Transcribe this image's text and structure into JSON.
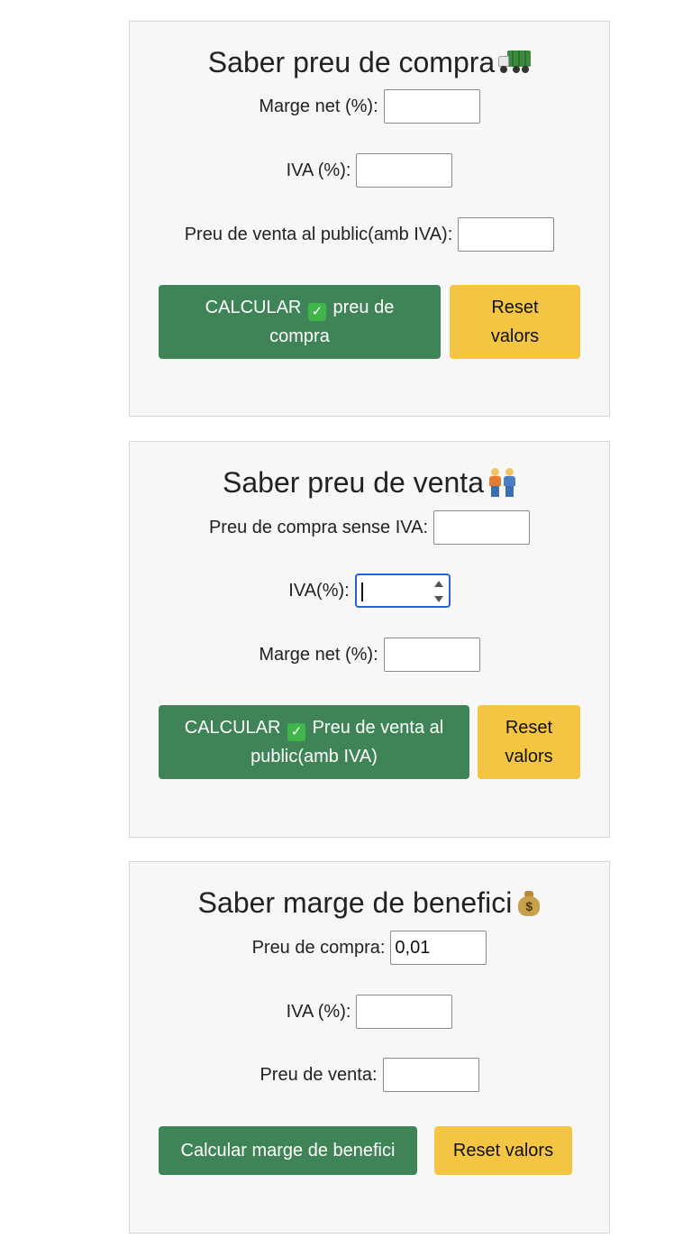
{
  "card_compra": {
    "title": "Saber preu de compra",
    "title_icon": "truck-icon",
    "fields": {
      "marge_label": "Marge net (%):",
      "marge_value": "",
      "iva_label": "IVA (%):",
      "iva_value": "",
      "pvp_label": "Preu de venta al public(amb IVA):",
      "pvp_value": ""
    },
    "calc_button_pre": "CALCULAR",
    "calc_button_line1_post": "preu de",
    "calc_button_line2": "compra",
    "reset_button_line1": "Reset",
    "reset_button_line2": "valors"
  },
  "card_venta": {
    "title": "Saber preu de venta",
    "title_icon": "people-holding-hands-icon",
    "fields": {
      "compra_label": "Preu de compra sense IVA:",
      "compra_value": "",
      "iva_label": "IVA(%):",
      "iva_value": "",
      "marge_label": "Marge net (%):",
      "marge_value": ""
    },
    "calc_button_pre": "CALCULAR",
    "calc_button_line1_post": "Preu de venta al",
    "calc_button_line2": "public(amb IVA)",
    "reset_button_line1": "Reset",
    "reset_button_line2": "valors"
  },
  "card_marge": {
    "title": "Saber marge de benefici",
    "title_icon": "money-bag-icon",
    "fields": {
      "compra_label": "Preu de compra:",
      "compra_value": "0,01",
      "iva_label": "IVA (%):",
      "iva_value": "",
      "venta_label": "Preu de venta:",
      "venta_value": ""
    },
    "calc_button": "Calcular marge de benefici",
    "reset_button": "Reset valors"
  },
  "colors": {
    "calc_button": "#3f8457",
    "reset_button": "#f4c542",
    "card_bg": "#f7f7f7",
    "focus_ring": "#2563c9",
    "checkmark": "#3fb54a"
  }
}
